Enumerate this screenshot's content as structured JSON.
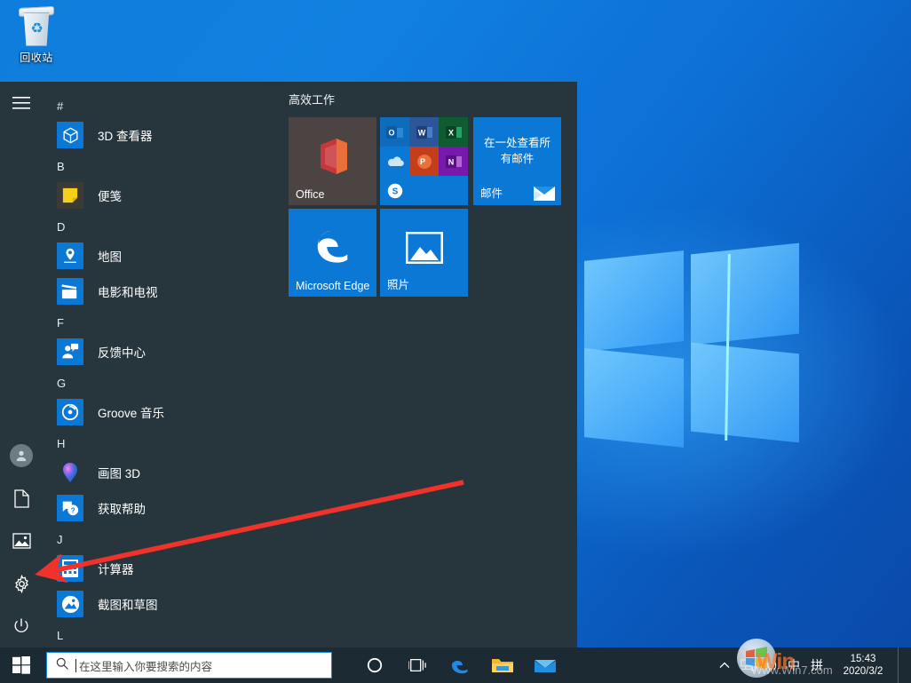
{
  "desktop": {
    "recycle_bin": {
      "label": "回收站",
      "icon": "recycle-bin-icon"
    }
  },
  "start_menu": {
    "hamburger": "menu-icon",
    "rail": [
      {
        "name": "user-account",
        "icon": "user-avatar-icon",
        "label": "用户"
      },
      {
        "name": "documents",
        "icon": "document-icon",
        "label": "文档"
      },
      {
        "name": "pictures",
        "icon": "picture-icon",
        "label": "图片"
      },
      {
        "name": "settings",
        "icon": "gear-icon",
        "label": "设置"
      },
      {
        "name": "power",
        "icon": "power-icon",
        "label": "电源"
      }
    ],
    "app_list": [
      {
        "letter": "#",
        "apps": [
          {
            "label": "3D 查看器",
            "icon": "3d-viewer-icon"
          }
        ]
      },
      {
        "letter": "B",
        "apps": [
          {
            "label": "便笺",
            "icon": "sticky-notes-icon"
          }
        ]
      },
      {
        "letter": "D",
        "apps": [
          {
            "label": "地图",
            "icon": "maps-icon"
          },
          {
            "label": "电影和电视",
            "icon": "movies-tv-icon"
          }
        ]
      },
      {
        "letter": "F",
        "apps": [
          {
            "label": "反馈中心",
            "icon": "feedback-hub-icon"
          }
        ]
      },
      {
        "letter": "G",
        "apps": [
          {
            "label": "Groove 音乐",
            "icon": "groove-music-icon"
          }
        ]
      },
      {
        "letter": "H",
        "apps": [
          {
            "label": "画图 3D",
            "icon": "paint-3d-icon"
          },
          {
            "label": "获取帮助",
            "icon": "get-help-icon"
          }
        ]
      },
      {
        "letter": "J",
        "apps": [
          {
            "label": "计算器",
            "icon": "calculator-icon"
          },
          {
            "label": "截图和草图",
            "icon": "snip-sketch-icon"
          }
        ]
      },
      {
        "letter": "L",
        "apps": []
      }
    ],
    "tiles": {
      "group_title": "高效工作",
      "items": [
        {
          "name": "office",
          "label": "Office",
          "icon": "office-icon",
          "color": "#4b4442"
        },
        {
          "name": "office-apps",
          "label": "",
          "icon": "office-apps-grid",
          "color": "#0a78d4"
        },
        {
          "name": "mail",
          "label": "邮件",
          "headline": "在一处查看所有邮件",
          "icon": "mail-envelope-icon",
          "color": "#0a78d4"
        },
        {
          "name": "edge",
          "label": "Microsoft Edge",
          "icon": "edge-icon",
          "color": "#0a78d4"
        },
        {
          "name": "photos",
          "label": "照片",
          "icon": "photos-icon",
          "color": "#0a78d4"
        }
      ],
      "office_apps": [
        {
          "name": "outlook",
          "glyph": "O",
          "color": "#0f6cbd"
        },
        {
          "name": "word",
          "glyph": "W",
          "color": "#2b579a"
        },
        {
          "name": "excel",
          "glyph": "X",
          "color": "#0f5c32"
        },
        {
          "name": "onedrive",
          "glyph": "",
          "color": "#0a78d4"
        },
        {
          "name": "powerpoint",
          "glyph": "P",
          "color": "#c43e1c"
        },
        {
          "name": "onenote",
          "glyph": "N",
          "color": "#7719aa"
        },
        {
          "name": "skype",
          "glyph": "S",
          "color": "#0a78d4"
        }
      ]
    }
  },
  "taskbar": {
    "start_button": "windows-logo-icon",
    "search": {
      "placeholder": "在这里输入你要搜索的内容",
      "value": "",
      "icon": "search-icon"
    },
    "buttons": [
      {
        "name": "cortana",
        "icon": "cortana-circle-icon"
      },
      {
        "name": "task-view",
        "icon": "task-view-icon"
      },
      {
        "name": "edge",
        "icon": "edge-icon"
      },
      {
        "name": "file-explorer",
        "icon": "folder-icon"
      },
      {
        "name": "mail",
        "icon": "mail-icon"
      }
    ],
    "tray": [
      {
        "name": "show-hidden-icons",
        "icon": "chevron-up-icon"
      },
      {
        "name": "network",
        "icon": "network-icon"
      },
      {
        "name": "volume",
        "icon": "speaker-icon"
      },
      {
        "name": "ime-mode",
        "icon": "ime-chinese-icon",
        "text": "中"
      },
      {
        "name": "ime-pinyin",
        "icon": "ime-pinyin-icon",
        "text": "拼"
      }
    ],
    "clock": {
      "time": "15:43",
      "date": "2020/3/2"
    },
    "show_desktop": "show-desktop-button"
  },
  "watermark": {
    "brand": "Win",
    "url": "Www.Win7.com"
  },
  "annotation": {
    "arrow": "red-arrow-pointing-to-settings"
  },
  "colors": {
    "menu_bg": "#27363d",
    "tile_blue": "#0a78d4",
    "taskbar": "#1b2a33",
    "accent_border": "#1b8ce3",
    "arrow_red": "#f0322a"
  }
}
